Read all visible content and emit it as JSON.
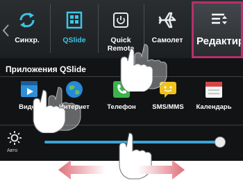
{
  "quick_settings": {
    "sync_label": "Синхр.",
    "qslide_label": "QSlide",
    "quick_remote_label": "Quick Remote",
    "airplane_label": "Самолет",
    "edit_label": "Редактир"
  },
  "qslide": {
    "title": "Приложения QSlide",
    "apps": [
      {
        "label": "Видео",
        "icon": "video-icon"
      },
      {
        "label": "Интернет",
        "icon": "globe-icon"
      },
      {
        "label": "Телефон",
        "icon": "phone-icon"
      },
      {
        "label": "SMS/MMS",
        "icon": "message-icon"
      },
      {
        "label": "Календарь",
        "icon": "calendar-icon"
      }
    ]
  },
  "brightness": {
    "auto_label": "Авто",
    "level": 0.96
  },
  "colors": {
    "accent_blue": "#3aa4d8",
    "edit_border": "#b8306a",
    "arrow_pink": "#e0707a"
  }
}
